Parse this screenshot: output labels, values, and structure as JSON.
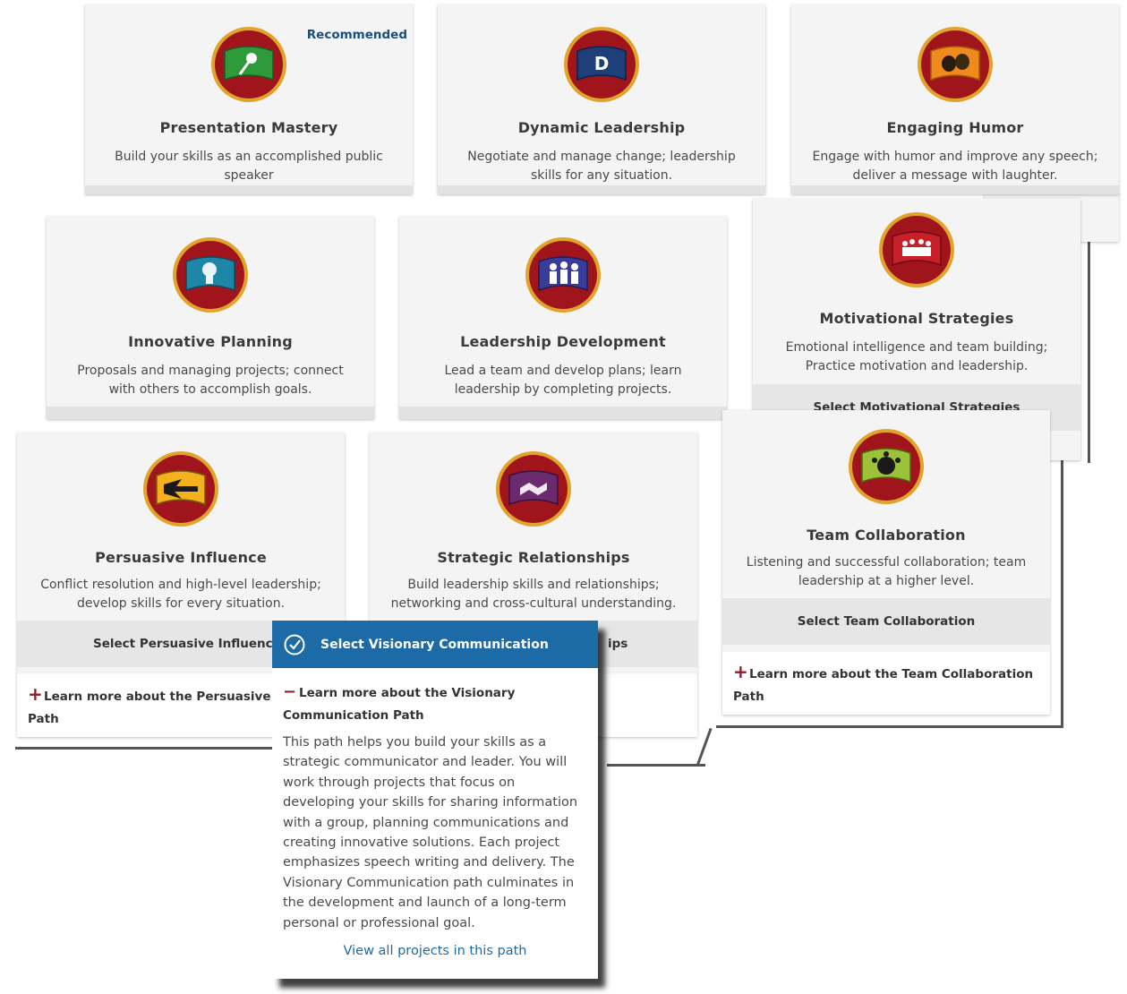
{
  "recommended_label": "Recommended",
  "paths": {
    "presentation_mastery": {
      "title": "Presentation Mastery",
      "description": "Build your skills as an accomplished public speaker",
      "flag_color": "#2f9a3a"
    },
    "dynamic_leadership": {
      "title": "Dynamic Leadership",
      "description": "Negotiate and manage change; leadership skills for any situation.",
      "flag_color": "#1f3f7a"
    },
    "engaging_humor": {
      "title": "Engaging Humor",
      "description": "Engage with humor and improve any speech; deliver a message with laughter.",
      "flag_color": "#f08a1c"
    },
    "innovative_planning": {
      "title": "Innovative Planning",
      "description": "Proposals and managing projects; connect with others to accomplish goals.",
      "flag_color": "#1e87a8"
    },
    "leadership_development": {
      "title": "Leadership Development",
      "description": "Lead a team and develop plans; learn leadership by completing projects.",
      "flag_color": "#3a3c9a"
    },
    "motivational_strategies": {
      "title": "Motivational Strategies",
      "description": "Emotional intelligence and team building; Practice motivation and leadership.",
      "select_label": "Select Motivational Strategies",
      "flag_color": "#c8202a"
    },
    "persuasive_influence": {
      "title": "Persuasive Influence",
      "description": "Conflict resolution and high-level leadership; develop skills for every situation.",
      "select_label": "Select Persuasive Influence",
      "learn_line1": "Learn more about the Persuasive I",
      "learn_line2": "Path",
      "flag_color": "#f3b21d"
    },
    "strategic_relationships": {
      "title": "Strategic Relationships",
      "description": "Build leadership skills and relationships; networking and cross-cultural understanding.",
      "select_fragment": "ips",
      "flag_color": "#6a2a6e"
    },
    "team_collaboration": {
      "title": "Team Collaboration",
      "description": "Listening and successful collaboration; team leadership at a higher level.",
      "select_label": "Select Team Collaboration",
      "learn_line1": "Learn more about the Team Collaboration",
      "learn_line2": "Path",
      "flag_color": "#9cc23a"
    }
  },
  "visionary": {
    "select_label": "Select Visionary Communication",
    "learn_line1": "Learn more about the Visionary",
    "learn_line2": "Communication Path",
    "body": "This path helps you build your skills as a strategic communicator and leader. You will work through projects that focus on developing your skills for sharing information with a group, planning communications and creating innovative solutions. Each project emphasizes speech writing and delivery. The Visionary Communication path culminates in the development and launch of a long-term personal or professional goal.",
    "view_link": "View all projects in this path",
    "header_color": "#1c6aa6"
  },
  "icons": [
    "microphone-flag-icon",
    "d-logo-flag-icon",
    "theater-masks-flag-icon",
    "lightbulb-flag-icon",
    "people-flag-icon",
    "group-flag-icon",
    "directional-flag-icon",
    "handshake-flag-icon",
    "team-circle-flag-icon",
    "check-circle-icon",
    "plus-icon",
    "minus-icon"
  ]
}
